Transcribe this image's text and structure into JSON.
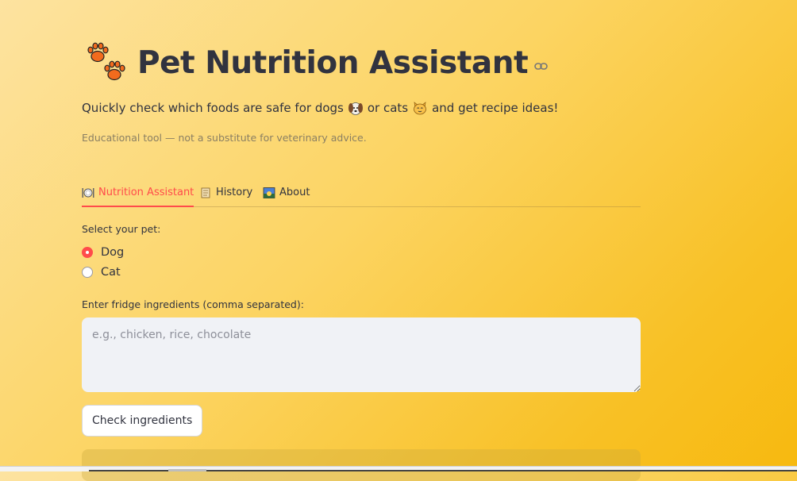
{
  "header": {
    "title": "Pet Nutrition Assistant",
    "title_icon": "paw-prints-icon",
    "anchor_icon": "link-icon",
    "subtitle_part1": "Quickly check which foods are safe for dogs",
    "subtitle_part2": "or cats",
    "subtitle_part3": "and get recipe ideas!",
    "caption": "Educational tool — not a substitute for veterinary advice."
  },
  "tabs": [
    {
      "label": "Nutrition Assistant",
      "icon": "plate-cutlery-icon",
      "active": true
    },
    {
      "label": "History",
      "icon": "scroll-icon",
      "active": false
    },
    {
      "label": "About",
      "icon": "sunrise-image-icon",
      "active": false
    }
  ],
  "pet_select": {
    "label": "Select your pet:",
    "options": [
      "Dog",
      "Cat"
    ],
    "selected": "Dog"
  },
  "ingredients": {
    "label": "Enter fridge ingredients (comma separated):",
    "placeholder": "e.g., chicken, rice, chocolate",
    "value": ""
  },
  "check_button": {
    "label": "Check ingredients"
  },
  "colors": {
    "accent": "#ff4b4b",
    "input_bg": "#f0f2f6",
    "text": "#31333f"
  }
}
